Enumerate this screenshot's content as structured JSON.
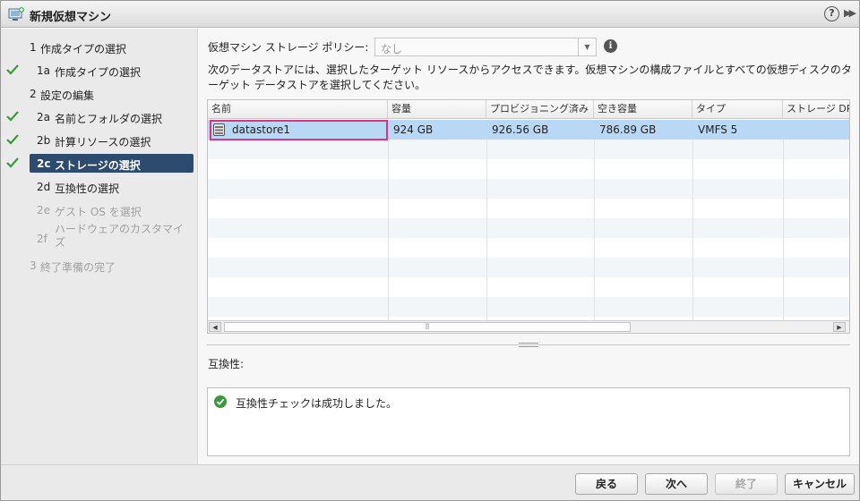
{
  "window": {
    "title": "新規仮想マシン",
    "help": "?",
    "expand": "▶▶"
  },
  "steps": [
    {
      "num": "1",
      "label": "作成タイプの選択",
      "state": "header"
    },
    {
      "num": "1a",
      "label": "作成タイプの選択",
      "state": "done"
    },
    {
      "num": "2",
      "label": "設定の編集",
      "state": "header"
    },
    {
      "num": "2a",
      "label": "名前とフォルダの選択",
      "state": "done"
    },
    {
      "num": "2b",
      "label": "計算リソースの選択",
      "state": "done"
    },
    {
      "num": "2c",
      "label": "ストレージの選択",
      "state": "active"
    },
    {
      "num": "2d",
      "label": "互換性の選択",
      "state": "pending"
    },
    {
      "num": "2e",
      "label": "ゲスト OS を選択",
      "state": "disabled"
    },
    {
      "num": "2f",
      "label": "ハードウェアのカスタマイズ",
      "state": "disabled"
    },
    {
      "num": "3",
      "label": "終了準備の完了",
      "state": "disabled"
    }
  ],
  "storage": {
    "policy_label": "仮想マシン ストレージ ポリシー:",
    "policy_value": "なし",
    "description": "次のデータストアには、選択したターゲット リソースからアクセスできます。仮想マシンの構成ファイルとすべての仮想ディスクのターゲット データストアを選択してください。",
    "columns": [
      "名前",
      "容量",
      "プロビジョニング済み",
      "空き容量",
      "タイプ",
      "ストレージ DRS"
    ],
    "rows": [
      {
        "name": "datastore1",
        "capacity": "924 GB",
        "provisioned": "926.56 GB",
        "free": "786.89 GB",
        "type": "VMFS 5",
        "sdrs": ""
      }
    ],
    "scroll_left": "◀",
    "scroll_right": "▶",
    "scroll_grip": "⠿"
  },
  "compatibility": {
    "label": "互換性:",
    "message": "互換性チェックは成功しました。"
  },
  "footer": {
    "back": "戻る",
    "next": "次へ",
    "finish": "終了",
    "cancel": "キャンセル"
  },
  "colors": {
    "active_step": "#2c4b6e",
    "selected_row": "#b9d8f5",
    "check_green": "#3a9a3a",
    "focus_outline": "#e0337c"
  }
}
